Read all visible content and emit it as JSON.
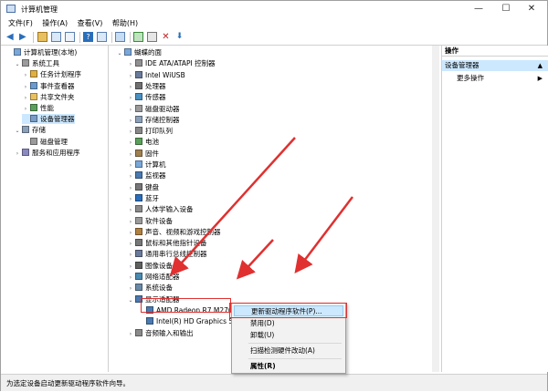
{
  "window": {
    "title": "计算机管理",
    "minimize": "—",
    "maximize": "☐",
    "close": "✕"
  },
  "menu": [
    "文件(F)",
    "操作(A)",
    "查看(V)",
    "帮助(H)"
  ],
  "left_tree": [
    {
      "label": "计算机管理(本地)",
      "level": 0,
      "exp": "",
      "icon": "computer-icon"
    },
    {
      "label": "系统工具",
      "level": 1,
      "exp": "⌄",
      "icon": "tools-icon"
    },
    {
      "label": "任务计划程序",
      "level": 2,
      "exp": "›",
      "icon": "clock-icon"
    },
    {
      "label": "事件查看器",
      "level": 2,
      "exp": "›",
      "icon": "event-icon"
    },
    {
      "label": "共享文件夹",
      "level": 2,
      "exp": "›",
      "icon": "folder-icon"
    },
    {
      "label": "性能",
      "level": 2,
      "exp": "›",
      "icon": "performance-icon"
    },
    {
      "label": "设备管理器",
      "level": 2,
      "exp": "",
      "icon": "device-manager-icon",
      "selected": true
    },
    {
      "label": "存储",
      "level": 1,
      "exp": "⌄",
      "icon": "storage-icon"
    },
    {
      "label": "磁盘管理",
      "level": 2,
      "exp": "",
      "icon": "disk-icon"
    },
    {
      "label": "服务和应用程序",
      "level": 1,
      "exp": "›",
      "icon": "services-icon"
    }
  ],
  "device_tree": [
    {
      "label": "蝴蝶的面",
      "level": 0,
      "exp": "⌄",
      "icon": "computer-icon"
    },
    {
      "label": "IDE ATA/ATAPI 控制器",
      "level": 1,
      "exp": "›",
      "icon": "ide-icon"
    },
    {
      "label": "Intel WiUSB",
      "level": 1,
      "exp": "›",
      "icon": "usb-icon"
    },
    {
      "label": "处理器",
      "level": 1,
      "exp": "›",
      "icon": "cpu-icon"
    },
    {
      "label": "传感器",
      "level": 1,
      "exp": "›",
      "icon": "sensor-icon"
    },
    {
      "label": "磁盘驱动器",
      "level": 1,
      "exp": "›",
      "icon": "disk-icon"
    },
    {
      "label": "存储控制器",
      "level": 1,
      "exp": "›",
      "icon": "storage-icon"
    },
    {
      "label": "打印队列",
      "level": 1,
      "exp": "›",
      "icon": "printer-icon"
    },
    {
      "label": "电池",
      "level": 1,
      "exp": "›",
      "icon": "battery-icon"
    },
    {
      "label": "固件",
      "level": 1,
      "exp": "›",
      "icon": "firmware-icon"
    },
    {
      "label": "计算机",
      "level": 1,
      "exp": "›",
      "icon": "computer-icon"
    },
    {
      "label": "监视器",
      "level": 1,
      "exp": "›",
      "icon": "monitor-icon"
    },
    {
      "label": "键盘",
      "level": 1,
      "exp": "›",
      "icon": "keyboard-icon"
    },
    {
      "label": "蓝牙",
      "level": 1,
      "exp": "›",
      "icon": "bluetooth-icon"
    },
    {
      "label": "人体学输入设备",
      "level": 1,
      "exp": "›",
      "icon": "hid-icon"
    },
    {
      "label": "软件设备",
      "level": 1,
      "exp": "›",
      "icon": "software-icon"
    },
    {
      "label": "声音、视频和游戏控制器",
      "level": 1,
      "exp": "›",
      "icon": "audio-icon"
    },
    {
      "label": "鼠标和其他指针设备",
      "level": 1,
      "exp": "›",
      "icon": "mouse-icon"
    },
    {
      "label": "通用串行总线控制器",
      "level": 1,
      "exp": "›",
      "icon": "usb-icon"
    },
    {
      "label": "图像设备",
      "level": 1,
      "exp": "›",
      "icon": "camera-icon"
    },
    {
      "label": "网络适配器",
      "level": 1,
      "exp": "›",
      "icon": "network-icon"
    },
    {
      "label": "系统设备",
      "level": 1,
      "exp": "›",
      "icon": "system-icon"
    },
    {
      "label": "显示适配器",
      "level": 1,
      "exp": "⌄",
      "icon": "display-icon"
    },
    {
      "label": "AMD Radeon R7 M270",
      "level": 2,
      "exp": "",
      "icon": "gpu-icon"
    },
    {
      "label": "Intel(R) HD Graphics 55",
      "level": 2,
      "exp": "",
      "icon": "gpu-icon"
    },
    {
      "label": "音频输入和输出",
      "level": 1,
      "exp": "›",
      "icon": "speaker-icon"
    }
  ],
  "actions": {
    "header": "操作",
    "section": "设备管理器",
    "more": "更多操作"
  },
  "context_menu": [
    "更新驱动程序软件(P)...",
    "禁用(D)",
    "卸载(U)",
    "扫描检测硬件改动(A)",
    "属性(R)"
  ],
  "status_text": "为选定设备启动更新驱动程序软件向导。",
  "colors": {
    "selection": "#cce8ff",
    "highlight_border": "#e03030",
    "arrow": "#e03030"
  }
}
